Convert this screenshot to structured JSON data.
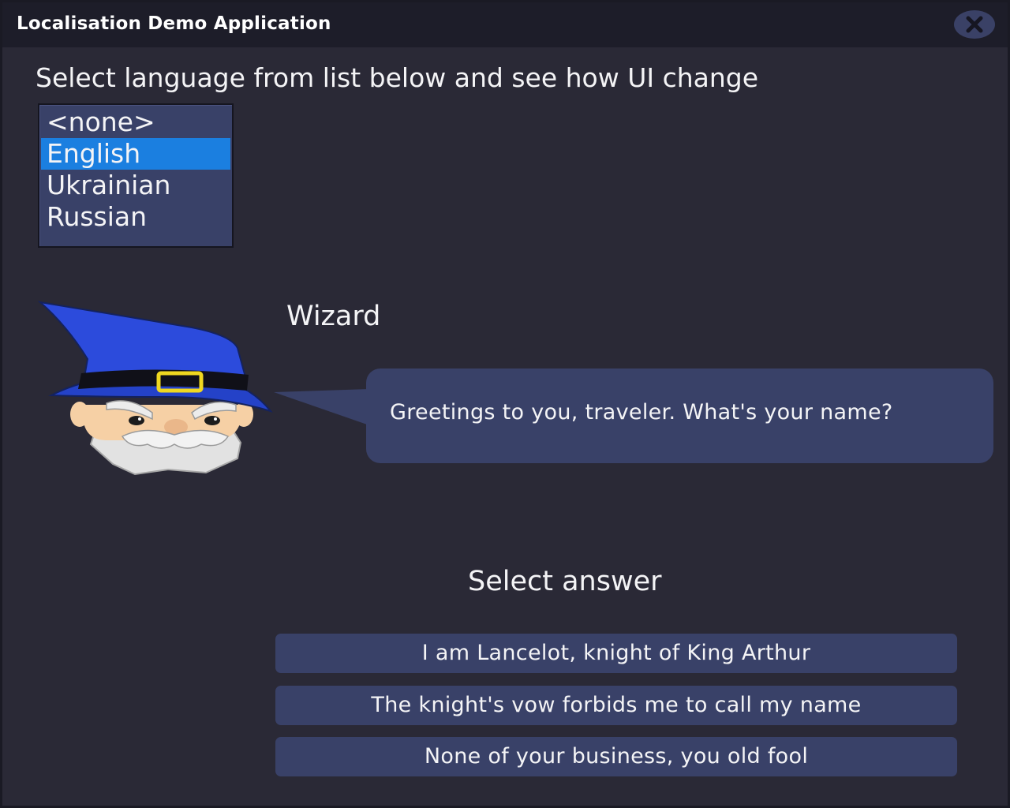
{
  "window": {
    "title": "Localisation Demo Application",
    "close_icon": "close-icon"
  },
  "instruction": "Select language from list below and see how UI change",
  "language_list": {
    "items": [
      "<none>",
      "English",
      "Ukrainian",
      "Russian"
    ],
    "selected": "English"
  },
  "dialog": {
    "speaker_name": "Wizard",
    "speaker_avatar": "wizard-avatar",
    "message": "Greetings to you, traveler. What's your name?"
  },
  "answers": {
    "heading": "Select answer",
    "options": [
      "I am Lancelot, knight of King Arthur",
      "The knight's vow forbids me to call my name",
      "None of your business, you old fool"
    ]
  },
  "colors": {
    "window_background": "#2a2936",
    "title_bar": "#1d1d29",
    "panel": "#394168",
    "selection": "#1b7fe0",
    "text": "#f4f4f6"
  }
}
